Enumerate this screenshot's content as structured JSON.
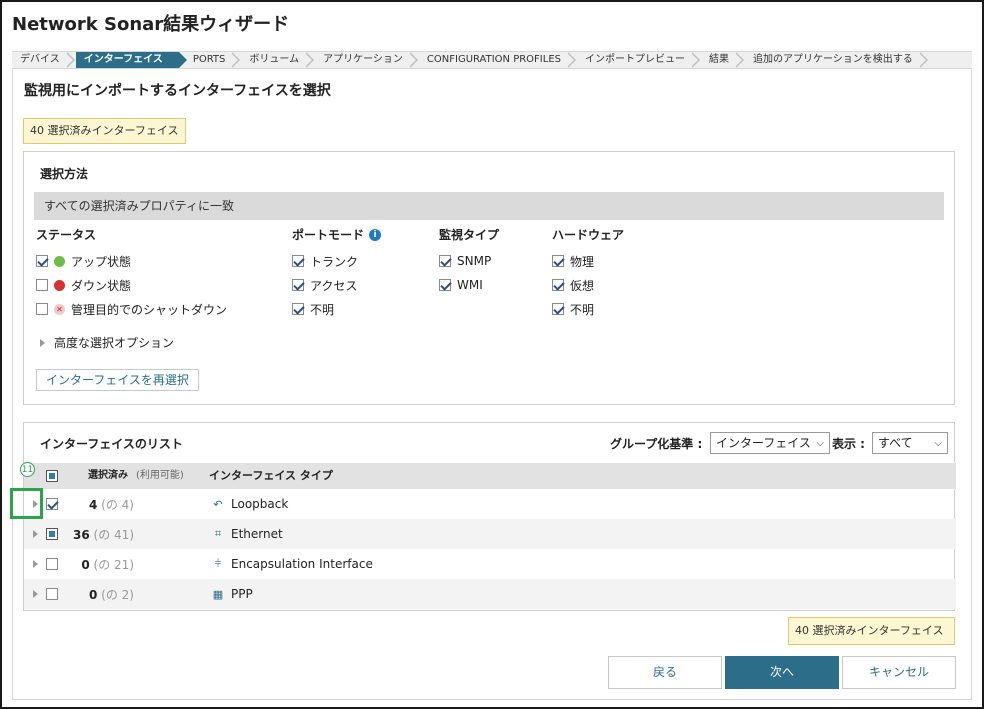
{
  "window": {
    "title": "Network Sonar結果ウィザード"
  },
  "breadcrumb": [
    {
      "label": "デバイス",
      "active": false
    },
    {
      "label": "インターフェイス",
      "active": true
    },
    {
      "label": "PORTS",
      "active": false
    },
    {
      "label": "ボリューム",
      "active": false
    },
    {
      "label": "アプリケーション",
      "active": false
    },
    {
      "label": "CONFIGURATION PROFILES",
      "active": false
    },
    {
      "label": "インポートプレビュー",
      "active": false
    },
    {
      "label": "結果",
      "active": false
    },
    {
      "label": "追加のアプリケーションを検出する",
      "active": false
    }
  ],
  "page": {
    "heading": "監視用にインポートするインターフェイスを選択",
    "selected_badge": "40 選択済みインターフェイス"
  },
  "selection": {
    "title": "選択方法",
    "match_all": "すべての選択済みプロパティに一致",
    "status": {
      "header": "ステータス",
      "up": "アップ状態",
      "down": "ダウン状態",
      "admin_down": "管理目的でのシャットダウン"
    },
    "port_mode": {
      "header": "ポートモード",
      "trunk": "トランク",
      "access": "アクセス",
      "unknown": "不明"
    },
    "monitor_type": {
      "header": "監視タイプ",
      "snmp": "SNMP",
      "wmi": "WMI"
    },
    "hardware": {
      "header": "ハードウェア",
      "physical": "物理",
      "virtual": "仮想",
      "unknown": "不明"
    },
    "advanced": "高度な選択オプション",
    "reselect_button": "インターフェイスを再選択"
  },
  "list": {
    "title": "インターフェイスのリスト",
    "group_by_label": "グループ化基準 :",
    "group_by_value": "インターフェイス",
    "show_label": "表示 :",
    "show_value": "すべて",
    "col_selected": "選択済み",
    "col_available": "(利用可能)",
    "col_type": "インターフェイス タイプ",
    "marker": "11",
    "rows": [
      {
        "selected": "4",
        "available": "(の 4)",
        "type": "Loopback",
        "icon": "loopback-icon",
        "state": "checked"
      },
      {
        "selected": "36",
        "available": "(の 41)",
        "type": "Ethernet",
        "icon": "ethernet-icon",
        "state": "partial"
      },
      {
        "selected": "0",
        "available": "(の 21)",
        "type": "Encapsulation Interface",
        "icon": "encapsulation-icon",
        "state": "unchecked"
      },
      {
        "selected": "0",
        "available": "(の 2)",
        "type": "PPP",
        "icon": "ppp-icon",
        "state": "unchecked"
      }
    ]
  },
  "footer": {
    "selected_badge": "40 選択済みインターフェイス",
    "back": "戻る",
    "next": "次へ",
    "cancel": "キャンセル"
  }
}
